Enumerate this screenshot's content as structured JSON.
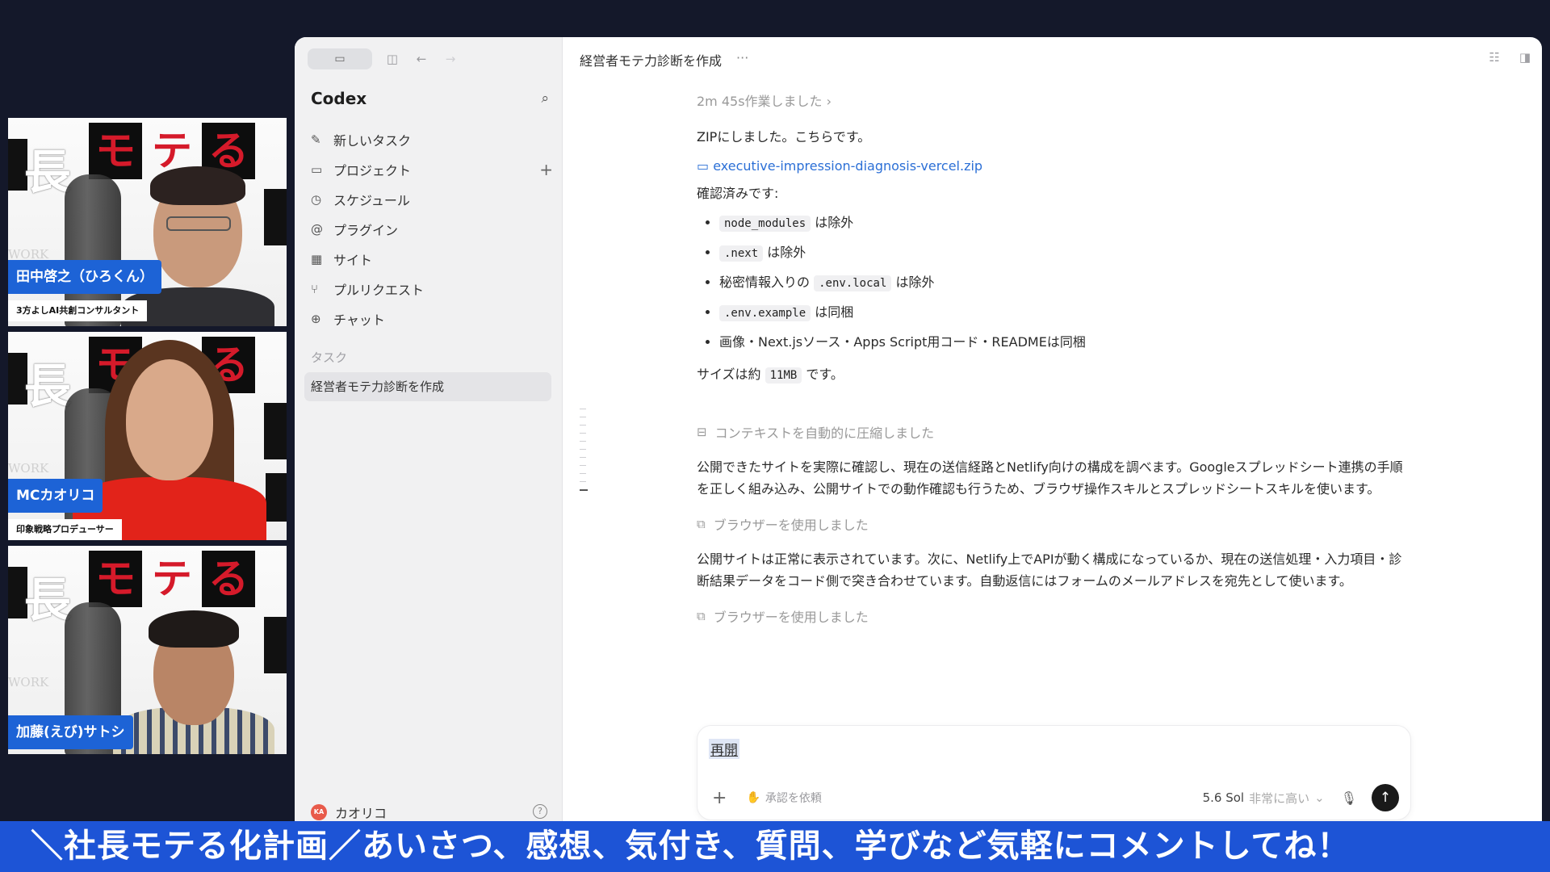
{
  "participants": [
    {
      "name": "田中啓之（ひろくん）",
      "role": "3方よしAI共創コンサルタント"
    },
    {
      "name": "MCカオリコ",
      "role": "印象戦略プロデューサー"
    },
    {
      "name": "加藤(えび)サトシ",
      "role": ""
    }
  ],
  "poster": {
    "chars_main": "長",
    "chars_boxed": [
      "モ",
      "テ",
      "る"
    ],
    "side_text": "WORK"
  },
  "sidebar": {
    "title": "Codex",
    "nav": [
      {
        "label": "新しいタスク",
        "icon": "edit-icon"
      },
      {
        "label": "プロジェクト",
        "icon": "folder-icon"
      },
      {
        "label": "スケジュール",
        "icon": "clock-icon"
      },
      {
        "label": "プラグイン",
        "icon": "at-icon"
      },
      {
        "label": "サイト",
        "icon": "grid-icon"
      },
      {
        "label": "プルリクエスト",
        "icon": "pull-request-icon"
      },
      {
        "label": "チャット",
        "icon": "chat-icon"
      }
    ],
    "section_label": "タスク",
    "active_task": "経営者モテ力診断を作成",
    "user": {
      "name": "カオリコ",
      "initials": "KA"
    }
  },
  "header": {
    "title": "経営者モテ力診断を作成",
    "more": "···"
  },
  "content": {
    "worked": "2m 45s作業しました",
    "zip_intro": "ZIPにしました。こちらです。",
    "zip_file": "executive-impression-diagnosis-vercel.zip",
    "verified": "確認済みです:",
    "bullets": [
      {
        "pre": "",
        "code": "node_modules",
        "post": " は除外"
      },
      {
        "pre": "",
        "code": ".next",
        "post": " は除外"
      },
      {
        "pre": "秘密情報入りの ",
        "code": ".env.local",
        "post": " は除外"
      },
      {
        "pre": "",
        "code": ".env.example",
        "post": " は同梱"
      },
      {
        "pre": "画像・Next.jsソース・Apps Script用コード・READMEは同梱",
        "code": "",
        "post": ""
      }
    ],
    "size_pre": "サイズは約 ",
    "size_code": "11MB",
    "size_post": " です。",
    "compressed": "コンテキストを自動的に圧縮しました",
    "para1": "公開できたサイトを実際に確認し、現在の送信経路とNetlify向けの構成を調べます。Googleスプレッドシート連携の手順を正しく組み込み、公開サイトでの動作確認も行うため、ブラウザ操作スキルとスプレッドシートスキルを使います。",
    "browser_used_1": "ブラウザーを使用しました",
    "para2": "公開サイトは正常に表示されています。次に、Netlify上でAPIが動く構成になっているか、現在の送信処理・入力項目・診断結果データをコード側で突き合わせています。自動返信にはフォームのメールアドレスを宛先として使います。",
    "browser_used_2": "ブラウザーを使用しました"
  },
  "composer": {
    "value": "再開",
    "approval": "承認を依頼",
    "model": "5.6 Sol",
    "level": "非常に高い"
  },
  "banner": "＼社長モテる化計画／あいさつ、感想、気付き、質問、学びなど気軽にコメントしてね！"
}
